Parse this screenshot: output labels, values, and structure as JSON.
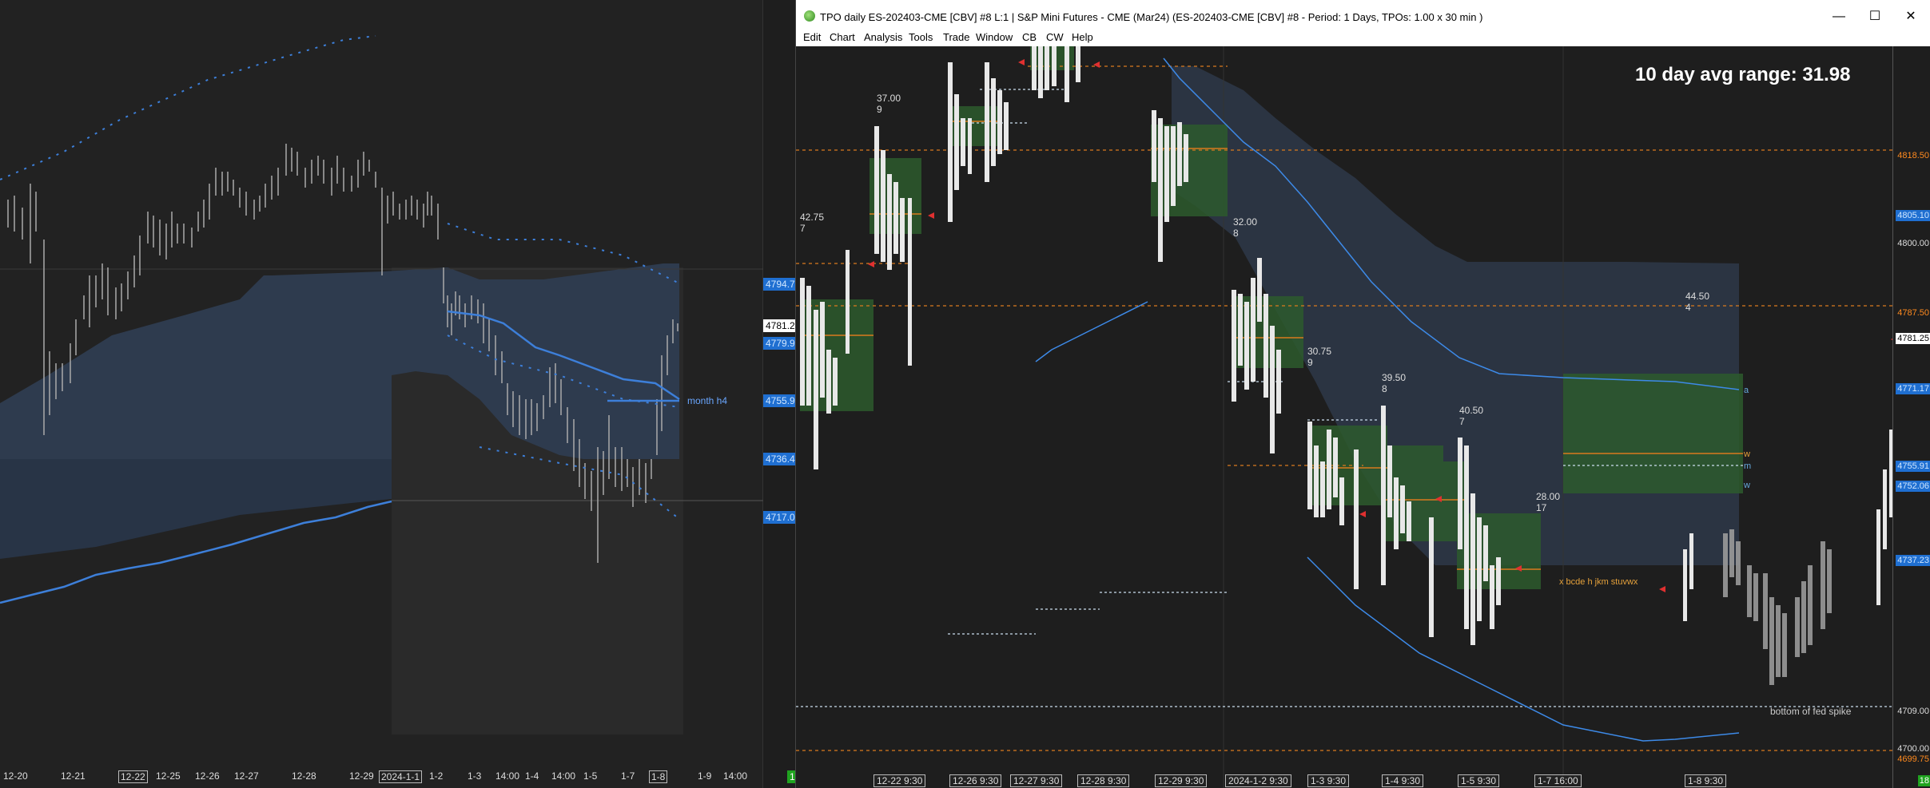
{
  "left_chart": {
    "price_tags": {
      "p1": "4794.7",
      "p2": "4781.25",
      "p3": "4779.9",
      "p4": "4755.91",
      "p5": "4736.4",
      "p6": "4717.0"
    },
    "month_label": "month h4",
    "x_labels": [
      "12-20",
      "12-21",
      "12-22",
      "12-25",
      "12-26",
      "12-27",
      "12-28",
      "12-29",
      "2024-1-1",
      "1-2",
      "1-3",
      "14:00",
      "1-4",
      "14:00",
      "1-5",
      "1-7",
      "1-8",
      "1-9",
      "14:00"
    ],
    "green_tag": "1"
  },
  "window": {
    "title": "TPO daily ES-202403-CME [CBV] #8 L:1 | S&P Mini Futures - CME (Mar24) (ES-202403-CME [CBV] #8 - Period: 1 Days, TPOs: 1.00 x 30 min  )",
    "minimize": "—",
    "maximize": "☐",
    "close": "✕",
    "menu": [
      "Edit",
      "Chart",
      "Analysis",
      "Tools",
      "Trade",
      "Window",
      "CB",
      "CW",
      "Help"
    ]
  },
  "chart": {
    "avg_range_label": "10 day avg range:  31.98",
    "annotations": [
      {
        "id": "a1",
        "range": "42.75",
        "count": "7"
      },
      {
        "id": "a2",
        "range": "37.00",
        "count": "9"
      },
      {
        "id": "a3",
        "range": "32.00",
        "count": "8"
      },
      {
        "id": "a4",
        "range": "30.75",
        "count": "9"
      },
      {
        "id": "a5",
        "range": "39.50",
        "count": "8"
      },
      {
        "id": "a6",
        "range": "40.50",
        "count": "7"
      },
      {
        "id": "a7",
        "range": "28.00",
        "count": "17"
      },
      {
        "id": "a8",
        "range": "44.50",
        "count": "4"
      }
    ],
    "fed_label": "bottom of fed spike",
    "level_letters": [
      "w",
      "m",
      "w",
      "a"
    ],
    "overlay_text": "x  bcde  h  jkm      stuvwx",
    "x_labels": [
      "12-22  9:30",
      "12-26  9:30",
      "12-27  9:30",
      "12-28  9:30",
      "12-29  9:30",
      "2024-1-2  9:30",
      "1-3  9:30",
      "1-4  9:30",
      "1-5  9:30",
      "1-7  16:00",
      "1-8  9:30"
    ]
  },
  "price_axis": {
    "tags": {
      "t4818": "4818.50",
      "t4805": "4805.10",
      "t4800": "4800.00",
      "t4787": "4787.50",
      "t4781": "4781.25",
      "t4771": "4771.17",
      "t4755": "4755.91",
      "t4752": "4752.06",
      "t4737": "4737.23",
      "t4709": "4709.00",
      "t4700": "4700.00",
      "t4699": "4699.75"
    },
    "green_tag": "18"
  },
  "colors": {
    "accent_blue": "#1f6fd1",
    "orange": "#ff8a1e",
    "value_area_green": "#2d5a2d",
    "volume_band": "#2e3b4e"
  }
}
